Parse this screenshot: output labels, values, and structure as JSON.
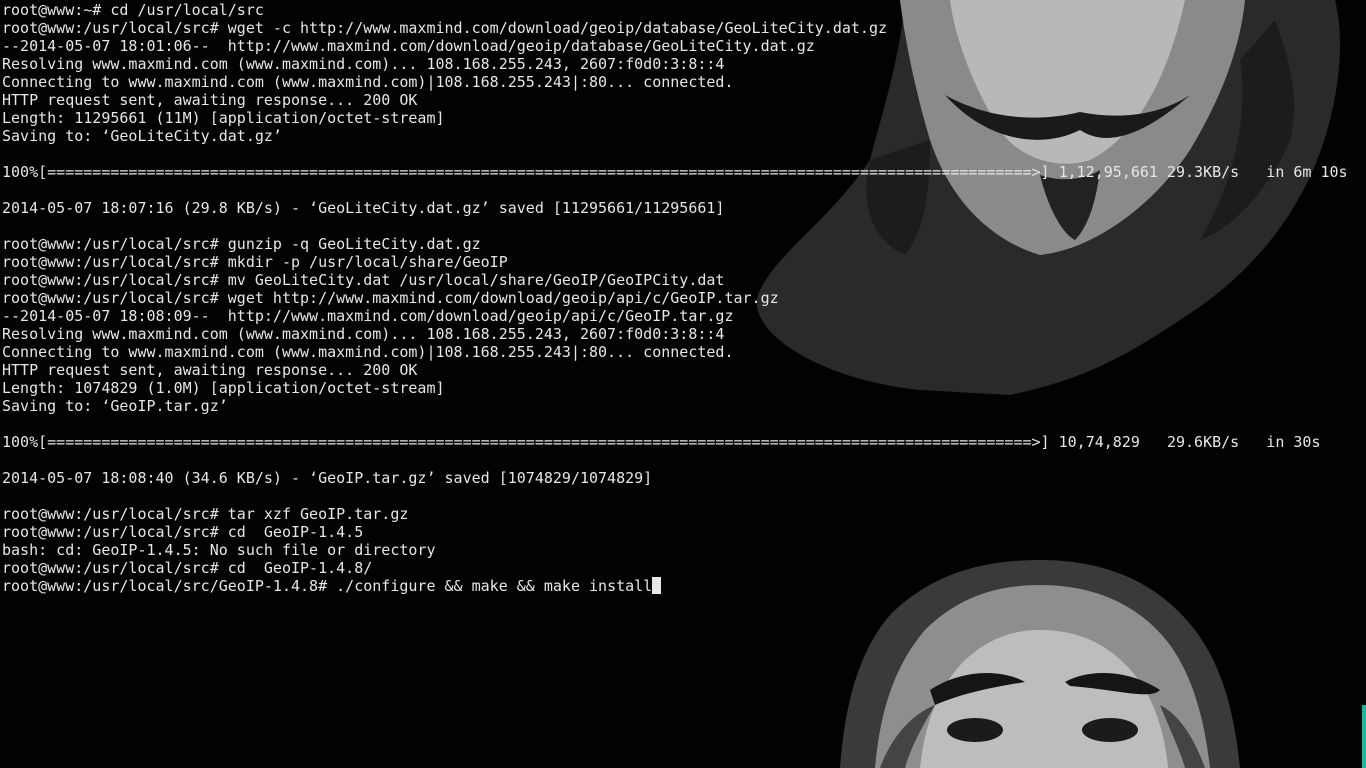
{
  "terminal": {
    "lines": [
      "root@www:~# cd /usr/local/src",
      "root@www:/usr/local/src# wget -c http://www.maxmind.com/download/geoip/database/GeoLiteCity.dat.gz",
      "--2014-05-07 18:01:06--  http://www.maxmind.com/download/geoip/database/GeoLiteCity.dat.gz",
      "Resolving www.maxmind.com (www.maxmind.com)... 108.168.255.243, 2607:f0d0:3:8::4",
      "Connecting to www.maxmind.com (www.maxmind.com)|108.168.255.243|:80... connected.",
      "HTTP request sent, awaiting response... 200 OK",
      "Length: 11295661 (11M) [application/octet-stream]",
      "Saving to: ‘GeoLiteCity.dat.gz’",
      "",
      "100%[=============================================================================================================>] 1,12,95,661 29.3KB/s   in 6m 10s",
      "",
      "2014-05-07 18:07:16 (29.8 KB/s) - ‘GeoLiteCity.dat.gz’ saved [11295661/11295661]",
      "",
      "root@www:/usr/local/src# gunzip -q GeoLiteCity.dat.gz",
      "root@www:/usr/local/src# mkdir -p /usr/local/share/GeoIP",
      "root@www:/usr/local/src# mv GeoLiteCity.dat /usr/local/share/GeoIP/GeoIPCity.dat",
      "root@www:/usr/local/src# wget http://www.maxmind.com/download/geoip/api/c/GeoIP.tar.gz",
      "--2014-05-07 18:08:09--  http://www.maxmind.com/download/geoip/api/c/GeoIP.tar.gz",
      "Resolving www.maxmind.com (www.maxmind.com)... 108.168.255.243, 2607:f0d0:3:8::4",
      "Connecting to www.maxmind.com (www.maxmind.com)|108.168.255.243|:80... connected.",
      "HTTP request sent, awaiting response... 200 OK",
      "Length: 1074829 (1.0M) [application/octet-stream]",
      "Saving to: ‘GeoIP.tar.gz’",
      "",
      "100%[=============================================================================================================>] 10,74,829   29.6KB/s   in 30s",
      "",
      "2014-05-07 18:08:40 (34.6 KB/s) - ‘GeoIP.tar.gz’ saved [1074829/1074829]",
      "",
      "root@www:/usr/local/src# tar xzf GeoIP.tar.gz",
      "root@www:/usr/local/src# cd  GeoIP-1.4.5",
      "bash: cd: GeoIP-1.4.5: No such file or directory",
      "root@www:/usr/local/src# cd  GeoIP-1.4.8/"
    ],
    "current_prompt": "root@www:/usr/local/src/GeoIP-1.4.8# ",
    "current_input": "./configure && make && make install"
  },
  "colors": {
    "background": "#020202",
    "foreground": "#e6e6e6",
    "accent": "#1fb5a0"
  }
}
